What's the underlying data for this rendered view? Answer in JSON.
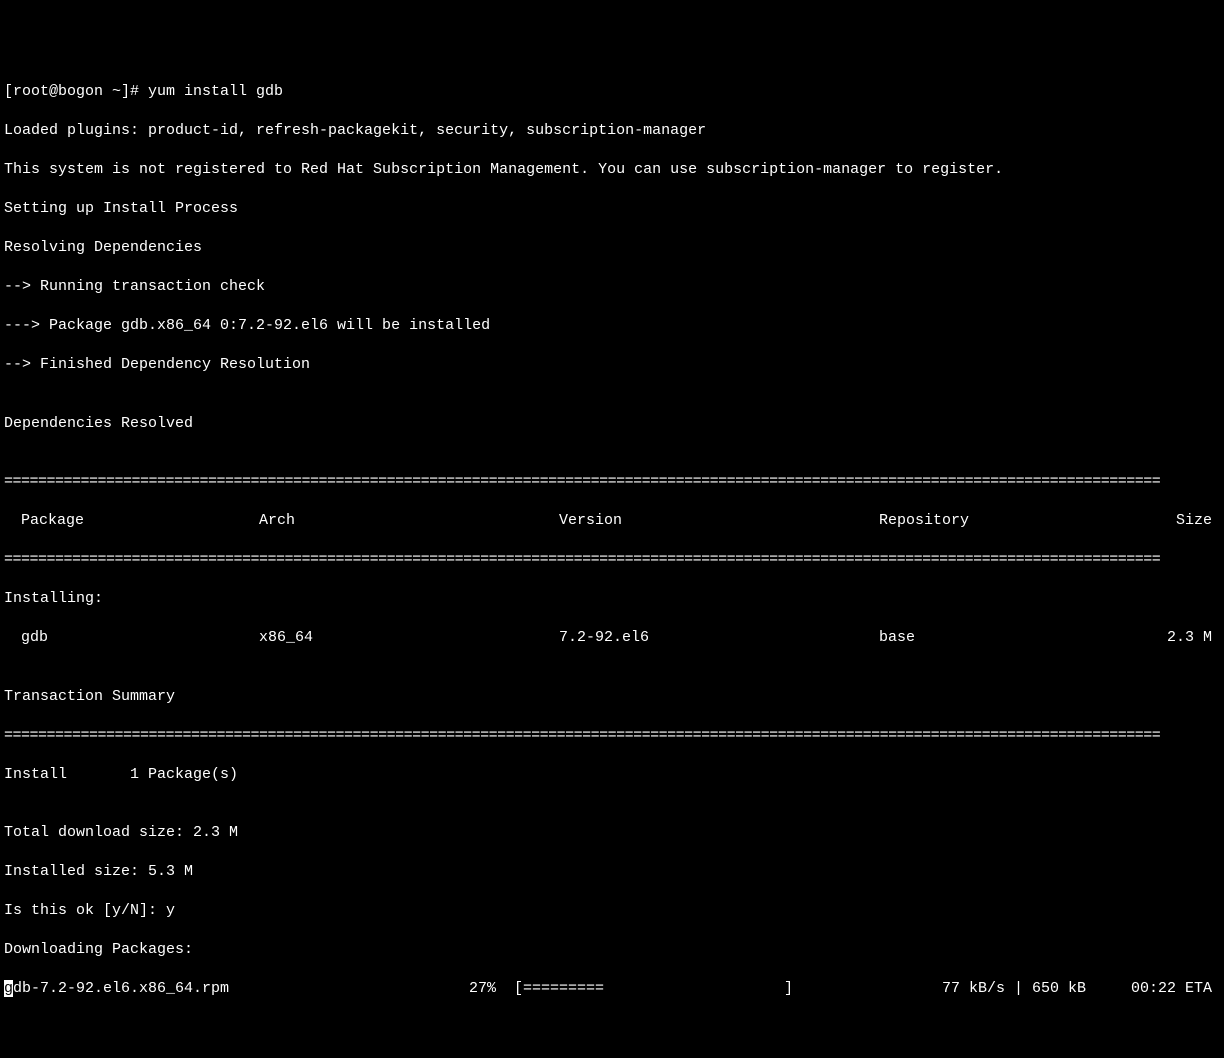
{
  "prompt": "[root@bogon ~]# yum install gdb",
  "output": {
    "l1": "Loaded plugins: product-id, refresh-packagekit, security, subscription-manager",
    "l2": "This system is not registered to Red Hat Subscription Management. You can use subscription-manager to register.",
    "l3": "Setting up Install Process",
    "l4": "Resolving Dependencies",
    "l5": "--> Running transaction check",
    "l6": "---> Package gdb.x86_64 0:7.2-92.el6 will be installed",
    "l7": "--> Finished Dependency Resolution",
    "l8": "",
    "l9": "Dependencies Resolved",
    "l10": ""
  },
  "sep1": "========================================================================================================================================",
  "headers": {
    "package": " Package",
    "arch": "Arch",
    "version": "Version",
    "repo": "Repository",
    "size": "Size"
  },
  "sep2": "========================================================================================================================================",
  "installing_label": "Installing:",
  "pkg_row": {
    "package": " gdb",
    "arch": "x86_64",
    "version": "7.2-92.el6",
    "repo": "base",
    "size": "2.3 M"
  },
  "blank": "",
  "trans_summary": "Transaction Summary",
  "sep3": "========================================================================================================================================",
  "install_count": "Install       1 Package(s)",
  "summary": {
    "l1": "",
    "l2": "Total download size: 2.3 M",
    "l3": "Installed size: 5.3 M",
    "l4": "Is this ok [y/N]: y",
    "l5": "Downloading Packages:"
  },
  "download": {
    "cursor_char": "g",
    "file": "db-7.2-92.el6.x86_64.rpm",
    "percent": "27%",
    "bar": "[=========                    ]",
    "stats": "  77 kB/s | 650 kB     00:22 ETA"
  }
}
